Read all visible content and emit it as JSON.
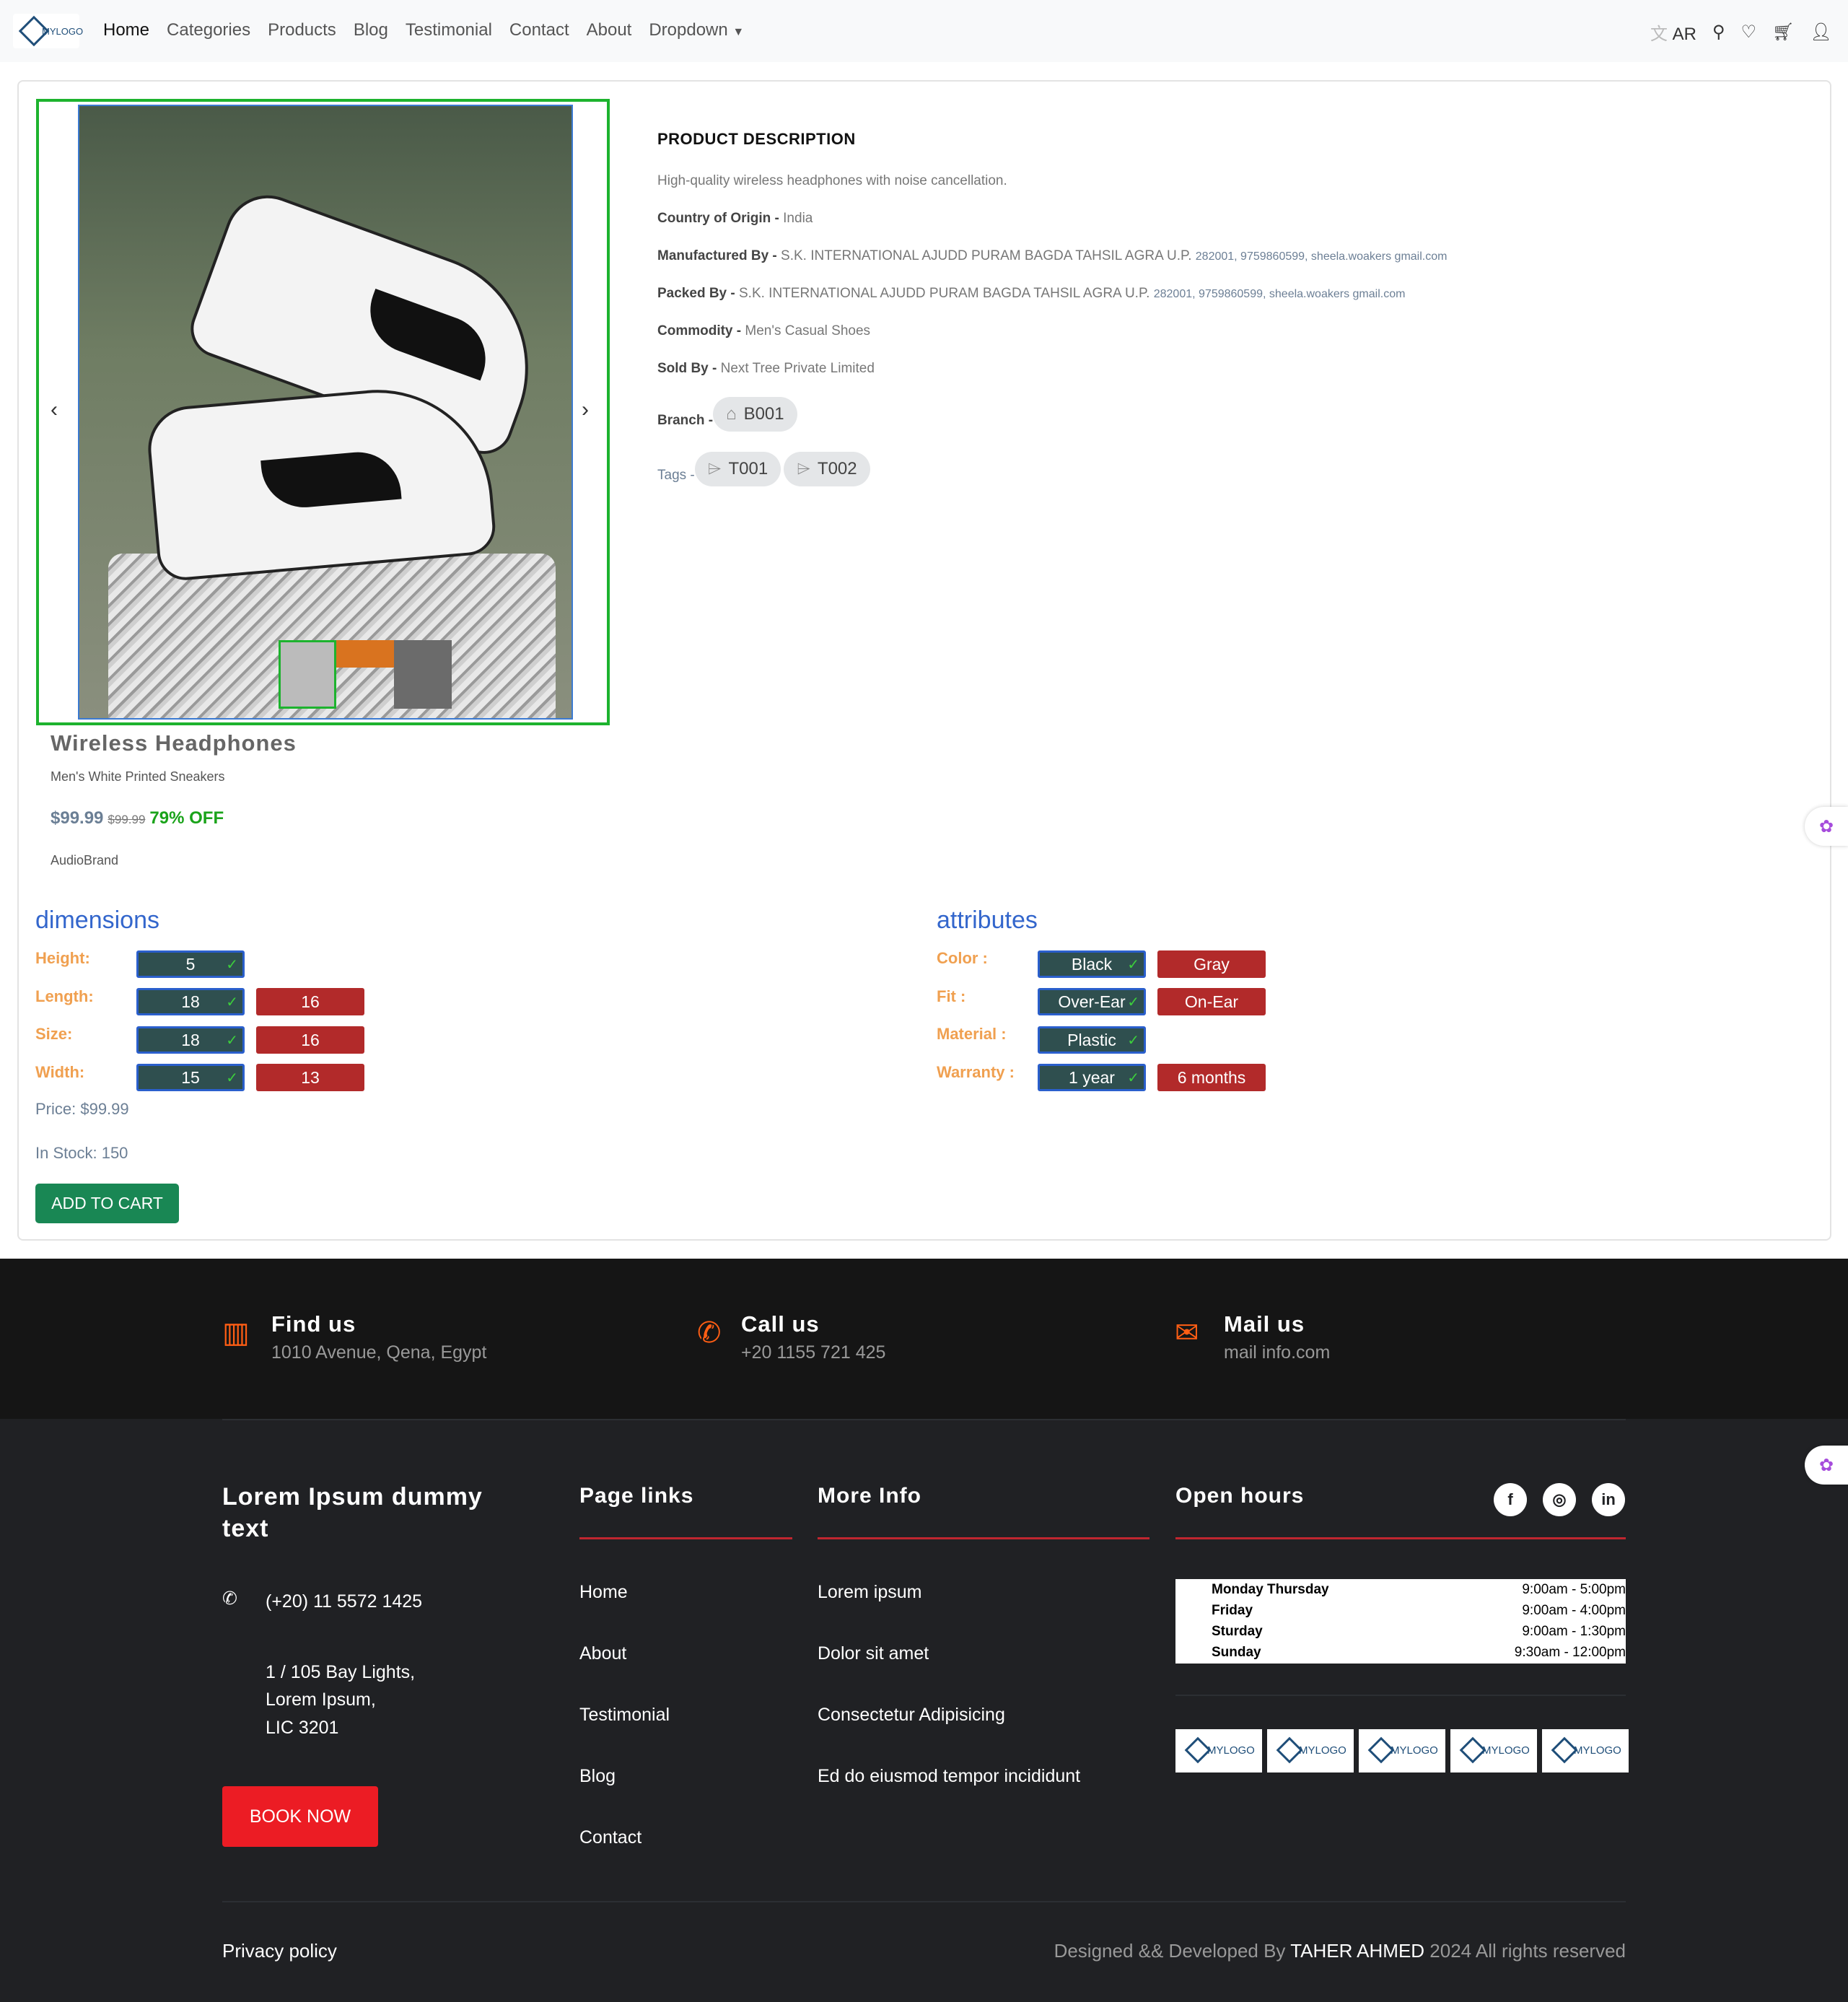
{
  "nav": {
    "logo_text": "MYLOGO",
    "links": [
      "Home",
      "Categories",
      "Products",
      "Blog",
      "Testimonial",
      "Contact",
      "About",
      "Dropdown"
    ],
    "lang": "AR"
  },
  "product": {
    "title": "Wireless Headphones",
    "subtitle": "Men's White Printed Sneakers",
    "price": "$99.99",
    "old_price": "$99.99",
    "discount": "79% OFF",
    "brand": "AudioBrand"
  },
  "description": {
    "heading": "PRODUCT DESCRIPTION",
    "summary": "High-quality wireless headphones with noise cancellation.",
    "origin_label": "Country of Origin - ",
    "origin_value": "India",
    "manufactured_label": "Manufactured By - ",
    "manufactured_value": "S.K. INTERNATIONAL AJUDD PURAM BAGDA TAHSIL AGRA U.P.",
    "manufactured_extra": "282001, 9759860599, sheela.woakers gmail.com",
    "packed_label": "Packed By - ",
    "packed_value": "S.K. INTERNATIONAL AJUDD PURAM BAGDA TAHSIL AGRA U.P.",
    "packed_extra": "282001, 9759860599, sheela.woakers gmail.com",
    "commodity_label": "Commodity - ",
    "commodity_value": "Men's Casual Shoes",
    "sold_label": "Sold By - ",
    "sold_value": "Next Tree Private Limited",
    "branch_label": "Branch - ",
    "branch": "B001",
    "tags_label": "Tags - ",
    "tags": [
      "T001",
      "T002"
    ]
  },
  "dimensions": {
    "heading": "dimensions",
    "height_label": "Height:",
    "length_label": "Length:",
    "size_label": "Size:",
    "width_label": "Width:",
    "height": [
      "5"
    ],
    "length": [
      "18",
      "16"
    ],
    "size": [
      "18",
      "16"
    ],
    "width": [
      "15",
      "13"
    ]
  },
  "attributes": {
    "heading": "attributes",
    "color_label": "Color :",
    "fit_label": "Fit :",
    "material_label": "Material :",
    "warranty_label": "Warranty :",
    "color": [
      "Black",
      "Gray"
    ],
    "fit": [
      "Over-Ear",
      "On-Ear"
    ],
    "material": [
      "Plastic"
    ],
    "warranty": [
      "1 year",
      "6 months"
    ]
  },
  "stock": {
    "price_text": "Price: $99.99",
    "stock_text": "In Stock: 150",
    "cart_button": "ADD TO CART"
  },
  "contact": {
    "find_title": "Find us",
    "find_text": "1010 Avenue, Qena, Egypt",
    "call_title": "Call us",
    "call_text": "+20 1155 721 425",
    "mail_title": "Mail us",
    "mail_text": "mail info.com"
  },
  "footer": {
    "about_title": "Lorem Ipsum dummy text",
    "phone": "(+20) 11 5572 1425",
    "address1": "1 / 105 Bay Lights,",
    "address2": "Lorem Ipsum,",
    "address3": "LIC 3201",
    "book": "BOOK NOW",
    "page_links_title": "Page links",
    "page_links": [
      "Home",
      "About",
      "Testimonial",
      "Blog",
      "Contact"
    ],
    "more_info_title": "More Info",
    "more_info": [
      "Lorem ipsum",
      "Dolor sit amet",
      "Consectetur Adipisicing",
      "Ed do eiusmod tempor incididunt"
    ],
    "open_hours_title": "Open hours",
    "hours": [
      {
        "day": "Monday Thursday",
        "time": "9:00am - 5:00pm"
      },
      {
        "day": "Friday",
        "time": "9:00am - 4:00pm"
      },
      {
        "day": "Sturday",
        "time": "9:00am - 1:30pm"
      },
      {
        "day": "Sunday",
        "time": "9:30am - 12:00pm"
      }
    ],
    "privacy": "Privacy policy",
    "credit_prefix": "Designed && Developed By ",
    "credit_name": "TAHER AHMED",
    "credit_suffix": " 2024 All rights reserved"
  },
  "colors": {
    "accent": "#ff5e14",
    "cart": "#198754",
    "book": "#ec1c24",
    "footer_bg": "#202124"
  }
}
